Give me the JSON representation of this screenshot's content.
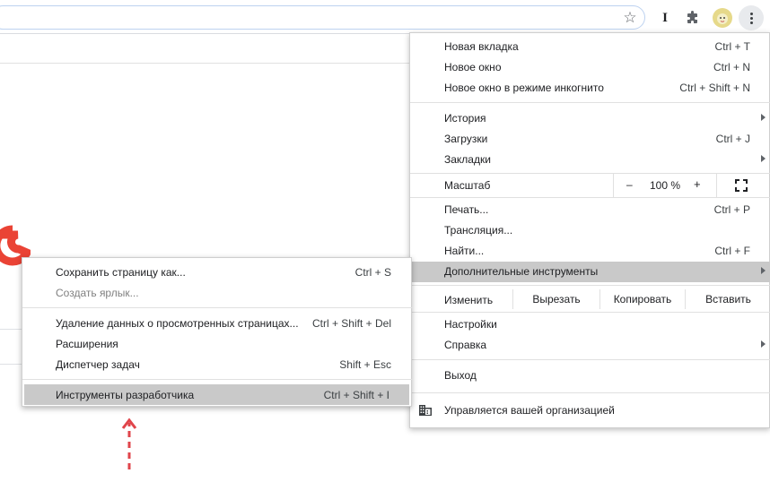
{
  "toolbar": {
    "star_icon": "star-icon",
    "ext_icon_label": "I",
    "extensions_icon": "puzzle-icon",
    "avatar_icon": "avatar-icon",
    "menu_icon": "kebab-menu-icon"
  },
  "colors": {
    "menu_highlight": "#c9c9c9",
    "annotation_red": "#e0454b",
    "logo_red": "#ea4335"
  },
  "main_menu": {
    "new_tab": {
      "label": "Новая вкладка",
      "shortcut": "Ctrl + T"
    },
    "new_window": {
      "label": "Новое окно",
      "shortcut": "Ctrl + N"
    },
    "incognito": {
      "label": "Новое окно в режиме инкогнито",
      "shortcut": "Ctrl + Shift + N"
    },
    "history": {
      "label": "История"
    },
    "downloads": {
      "label": "Загрузки",
      "shortcut": "Ctrl + J"
    },
    "bookmarks": {
      "label": "Закладки"
    },
    "zoom": {
      "label": "Масштаб",
      "minus": "–",
      "value": "100 %",
      "plus": "+"
    },
    "print": {
      "label": "Печать...",
      "shortcut": "Ctrl + P"
    },
    "cast": {
      "label": "Трансляция..."
    },
    "find": {
      "label": "Найти...",
      "shortcut": "Ctrl + F"
    },
    "more_tools": {
      "label": "Дополнительные инструменты"
    },
    "edit": {
      "label": "Изменить",
      "cut": "Вырезать",
      "copy": "Копировать",
      "paste": "Вставить"
    },
    "settings": {
      "label": "Настройки"
    },
    "help": {
      "label": "Справка"
    },
    "exit": {
      "label": "Выход"
    },
    "managed": {
      "label": "Управляется вашей организацией"
    }
  },
  "sub_menu": {
    "save_page": {
      "label": "Сохранить страницу как...",
      "shortcut": "Ctrl + S"
    },
    "create_shortcut": {
      "label": "Создать ярлык..."
    },
    "clear_data": {
      "label": "Удаление данных о просмотренных страницах...",
      "shortcut": "Ctrl + Shift + Del"
    },
    "extensions": {
      "label": "Расширения"
    },
    "task_manager": {
      "label": "Диспетчер задач",
      "shortcut": "Shift + Esc"
    },
    "dev_tools": {
      "label": "Инструменты разработчика",
      "shortcut": "Ctrl + Shift + I"
    }
  }
}
